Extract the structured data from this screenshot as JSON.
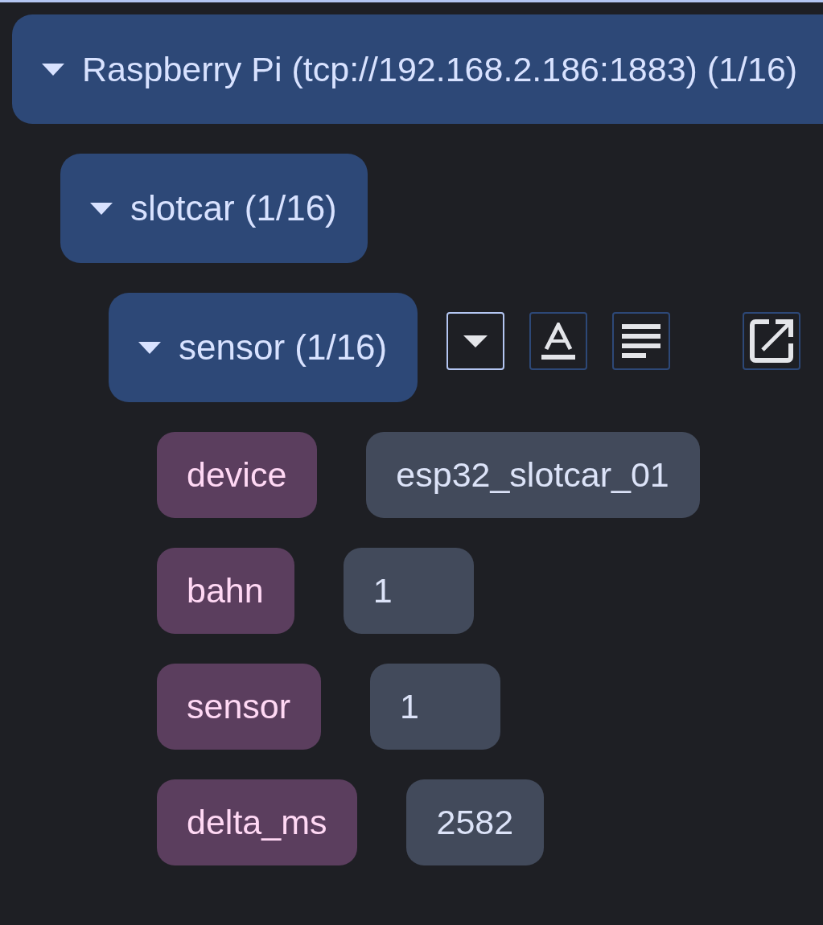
{
  "tree": [
    {
      "label": "Raspberry Pi (tcp://192.168.2.186:1883) (1/16)",
      "expanded": true,
      "children": [
        {
          "label": "slotcar (1/16)",
          "expanded": true,
          "children": [
            {
              "label": "sensor (1/16)",
              "expanded": true,
              "toolbar": [
                {
                  "kind": "dropdown",
                  "selected": true
                },
                {
                  "kind": "text-format",
                  "selected": false
                },
                {
                  "kind": "text-lines",
                  "selected": false
                },
                {
                  "kind": "open-external",
                  "selected": false
                }
              ],
              "fields": [
                {
                  "key": "device",
                  "value": "esp32_slotcar_01"
                },
                {
                  "key": "bahn",
                  "value": "1"
                },
                {
                  "key": "sensor",
                  "value": "1"
                },
                {
                  "key": "delta_ms",
                  "value": "2582"
                }
              ]
            }
          ]
        }
      ]
    }
  ]
}
